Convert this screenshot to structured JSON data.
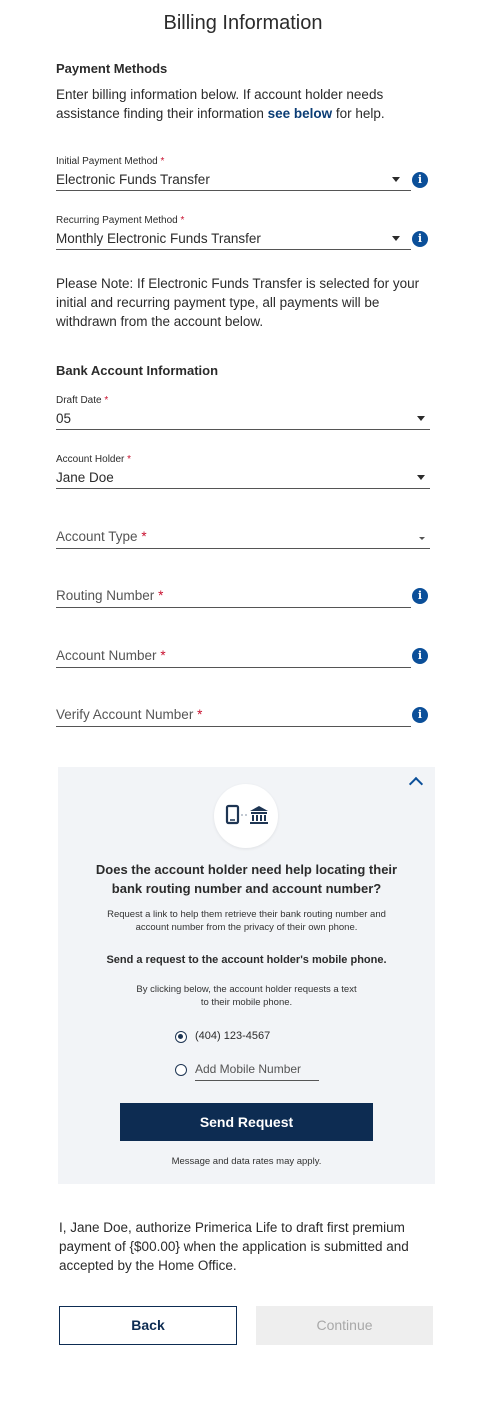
{
  "page_title": "Billing Information",
  "payment_methods": {
    "heading": "Payment Methods",
    "intro_prefix": "Enter billing information below. If account holder needs assistance finding their information ",
    "intro_link": "see below",
    "intro_suffix": " for help.",
    "initial": {
      "label": "Initial Payment Method",
      "value": "Electronic Funds Transfer"
    },
    "recurring": {
      "label": "Recurring Payment Method",
      "value": "Monthly Electronic Funds Transfer"
    },
    "note": "Please Note: If Electronic Funds Transfer is selected for your initial and recurring payment type, all payments will be withdrawn from the account below."
  },
  "bank_account": {
    "heading": "Bank Account Information",
    "draft_date": {
      "label": "Draft Date",
      "value": "05"
    },
    "account_holder": {
      "label": "Account Holder",
      "value": "Jane Doe"
    },
    "account_type": {
      "placeholder": "Account Type"
    },
    "routing_number": {
      "placeholder": "Routing Number"
    },
    "account_number": {
      "placeholder": "Account Number"
    },
    "verify_account_number": {
      "placeholder": "Verify Account Number"
    }
  },
  "required_mark": "*",
  "info_glyph": "i",
  "help_panel": {
    "question": "Does the account holder need help locating their bank routing number and account number?",
    "description": "Request a link to help them retrieve their bank routing number and account number from the privacy of their own phone.",
    "send_heading": "Send a request to the account holder's mobile phone.",
    "send_description": "By clicking below, the account holder requests a text to their mobile phone.",
    "phone_option": "(404) 123-4567",
    "add_mobile_placeholder": "Add Mobile Number",
    "send_button": "Send Request",
    "rates_note": "Message and data rates may apply."
  },
  "authorization": "I, Jane Doe, authorize Primerica Life to draft first premium payment of {$00.00} when the application is submitted and accepted by the Home Office.",
  "buttons": {
    "back": "Back",
    "continue": "Continue"
  },
  "colors": {
    "brand_navy": "#0d2c52",
    "info_blue": "#0b4f99",
    "required_red": "#c8102e",
    "disabled_gray": "#eeeeee"
  }
}
